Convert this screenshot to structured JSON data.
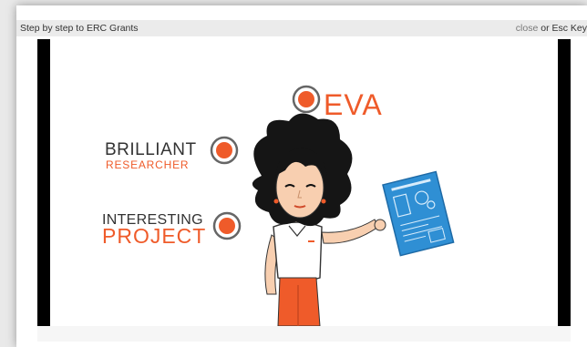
{
  "window": {
    "title": "Step by step to ERC Grants",
    "close_label": "close",
    "close_suffix": " or Esc Key"
  },
  "video": {
    "labels": {
      "eva": "EVA",
      "brilliant": "BRILLIANT",
      "researcher": "RESEARCHER",
      "interesting": "INTERESTING",
      "project": "PROJECT"
    }
  },
  "colors": {
    "accent": "#ef5b2a",
    "text_dark": "#333333",
    "blueprint": "#2f8fd4"
  },
  "icons": [
    "bullet-circle-icon",
    "character-illustration",
    "blueprint-document-icon"
  ]
}
